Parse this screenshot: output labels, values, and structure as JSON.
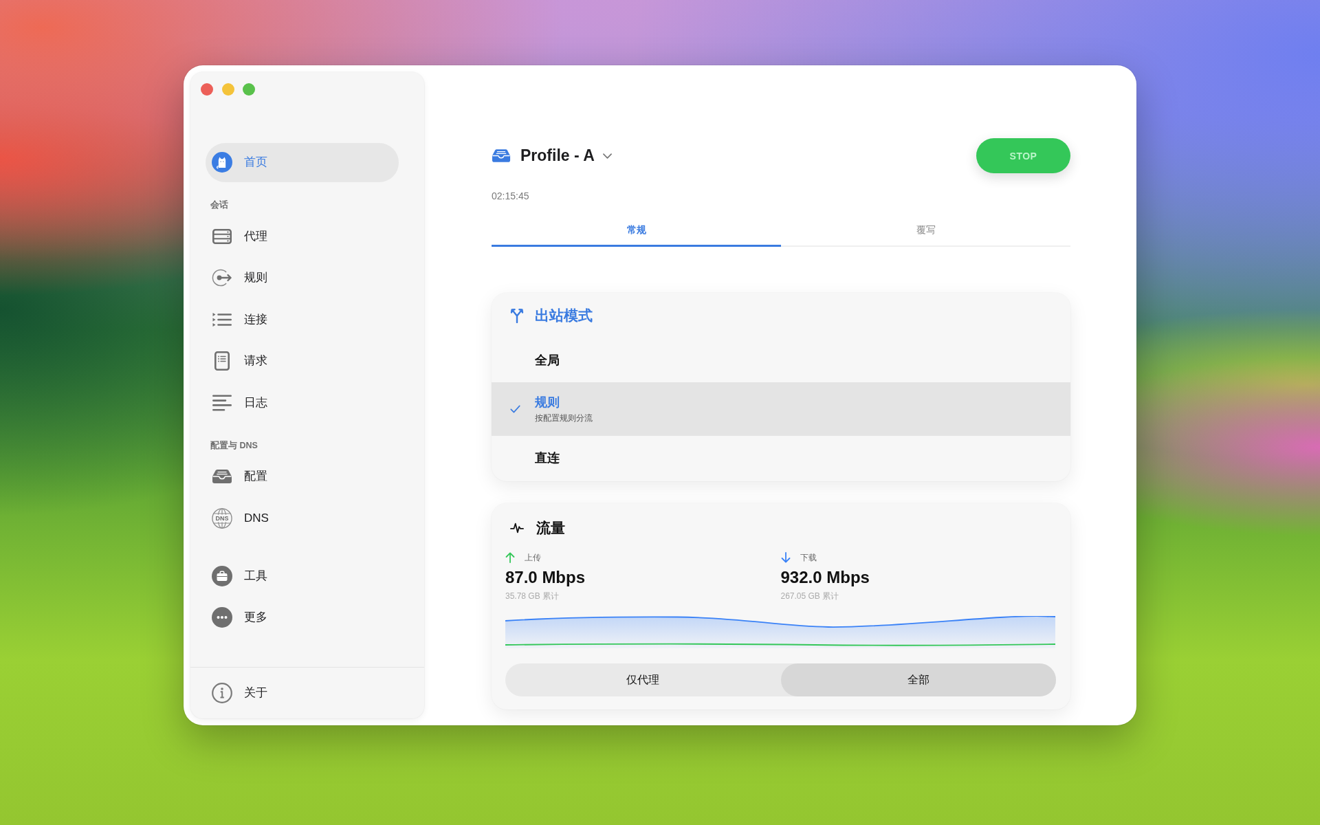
{
  "sidebar": {
    "groups": [
      {
        "items": [
          {
            "label": "首页",
            "selected": true
          }
        ]
      },
      {
        "heading": "会话",
        "items": [
          {
            "label": "代理",
            "selected": false
          },
          {
            "label": "规则",
            "selected": false
          },
          {
            "label": "连接",
            "selected": false
          },
          {
            "label": "请求",
            "selected": false
          },
          {
            "label": "日志",
            "selected": false
          }
        ]
      },
      {
        "heading": "配置与 DNS",
        "items": [
          {
            "label": "配置",
            "selected": false
          },
          {
            "label": "DNS",
            "icon_text": "DNS",
            "selected": false
          }
        ]
      },
      {
        "items": [
          {
            "label": "工具",
            "selected": false
          },
          {
            "label": "更多",
            "selected": false
          }
        ]
      }
    ],
    "footer": {
      "items": [
        {
          "label": "关于",
          "selected": false
        }
      ]
    }
  },
  "header": {
    "profile": "Profile - A",
    "button": "STOP",
    "uptime": "02:15:45"
  },
  "tabs": [
    {
      "label": "常规",
      "selected": true
    },
    {
      "label": "覆写",
      "selected": false
    }
  ],
  "outbound_mode": {
    "title": "出站模式",
    "options": [
      {
        "label": "全局",
        "selected": false
      },
      {
        "label": "规则",
        "description": "按配置规则分流",
        "selected": true
      },
      {
        "label": "直连",
        "selected": false
      }
    ]
  },
  "traffic": {
    "title": "流量",
    "stats": [
      {
        "kind": "upload",
        "label": "上传",
        "rate": "87.0 Mbps",
        "total": "35.78 GB 累计",
        "color": "#34c759"
      },
      {
        "kind": "download",
        "label": "下载",
        "rate": "932.0 Mbps",
        "total": "267.05 GB 累计",
        "color": "#3a82f7"
      }
    ],
    "scope": [
      {
        "label": "仅代理",
        "selected": false
      },
      {
        "label": "全部",
        "selected": true
      }
    ]
  }
}
